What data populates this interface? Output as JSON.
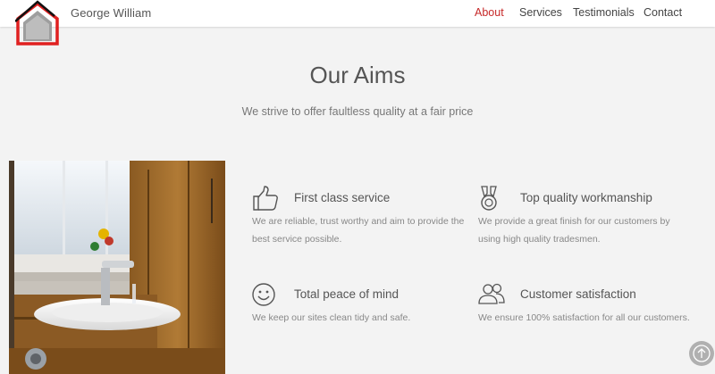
{
  "header": {
    "brand": "George William",
    "nav": [
      {
        "label": "About",
        "active": true
      },
      {
        "label": "Services",
        "active": false
      },
      {
        "label": "Testimonials",
        "active": false
      },
      {
        "label": "Contact",
        "active": false
      }
    ]
  },
  "section": {
    "title": "Our Aims",
    "subtitle": "We strive to offer faultless quality at a fair price"
  },
  "features": [
    {
      "icon": "thumbs-up-icon",
      "title": "First class service",
      "text": "We are reliable, trust worthy and aim to provide the best service possible."
    },
    {
      "icon": "medal-icon",
      "title": "Top quality workmanship",
      "text": "We provide a great finish for our customers by using high quality tradesmen."
    },
    {
      "icon": "smiley-icon",
      "title": "Total peace of mind",
      "text": "We keep our sites clean tidy and safe."
    },
    {
      "icon": "users-icon",
      "title": "Customer satisfaction",
      "text": "We ensure 100% satisfaction for all our customers."
    }
  ],
  "colors": {
    "accent": "#c62828",
    "background": "#f3f3f3",
    "header_bg": "#ffffff"
  }
}
